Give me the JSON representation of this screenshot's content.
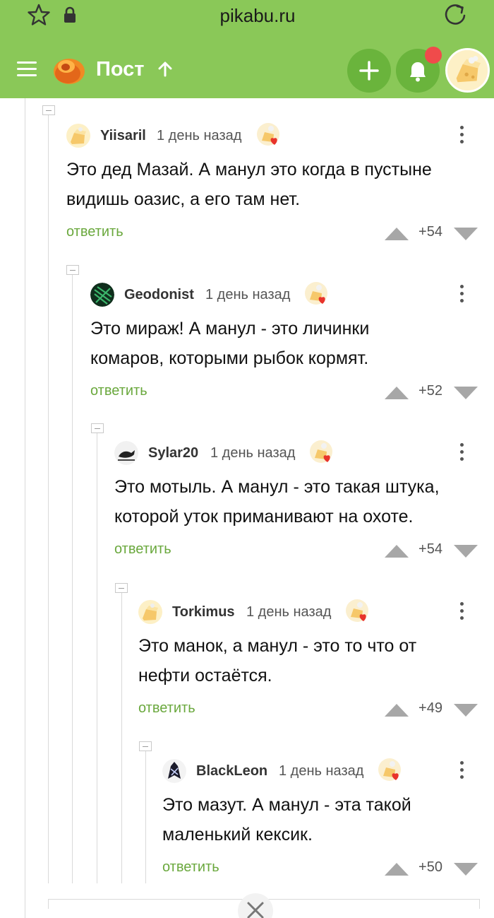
{
  "browser": {
    "url": "pikabu.ru",
    "icons": [
      "star-icon",
      "lock-icon",
      "reload-icon"
    ]
  },
  "header": {
    "title": "Пост",
    "icons": [
      "menu-icon",
      "pikabu-logo",
      "arrow-up-icon",
      "plus-icon",
      "bell-icon",
      "user-avatar"
    ],
    "accent_color": "#8ac858",
    "button_color": "#6ab43c",
    "notification_color": "#f04b4b"
  },
  "comments": [
    {
      "user": "Yiisaril",
      "time": "1 день назад",
      "text_lines": [
        "Это дед Мазай. А манул это когда в пустыне",
        "видишь оазис, а его там нет."
      ],
      "reply": "ответить",
      "rating": "+54"
    },
    {
      "user": "Geodonist",
      "time": "1 день назад",
      "text_lines": [
        "Это мираж! А манул - это личинки",
        "комаров, которыми рыбок кормят."
      ],
      "reply": "ответить",
      "rating": "+52"
    },
    {
      "user": "Sylar20",
      "time": "1 день назад",
      "text_lines": [
        "Это мотыль. А манул - это такая штука,",
        "которой уток приманивают на охоте."
      ],
      "reply": "ответить",
      "rating": "+54"
    },
    {
      "user": "Torkimus",
      "time": "1 день назад",
      "text_lines": [
        "Это манок, а манул - это то что от",
        "нефти остаётся."
      ],
      "reply": "ответить",
      "rating": "+49"
    },
    {
      "user": "BlackLeon",
      "time": "1 день назад",
      "text_lines": [
        "Это мазут. А манул - эта такой",
        "маленький кексик."
      ],
      "reply": "ответить",
      "rating": "+50"
    }
  ],
  "reply_color": "#6aa83d"
}
